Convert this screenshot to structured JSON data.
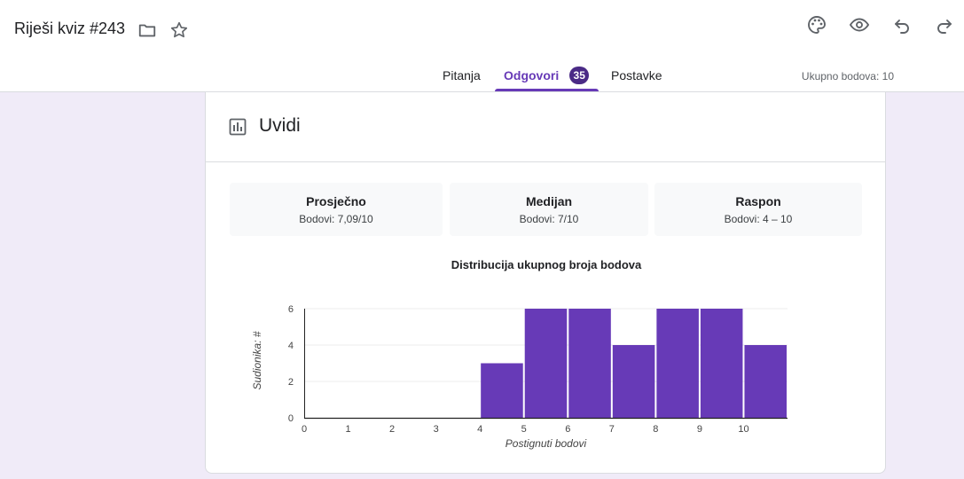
{
  "header": {
    "title": "Riješi kviz #243",
    "icons": [
      "folder-icon",
      "star-icon",
      "palette-icon",
      "eye-icon",
      "undo-icon",
      "redo-icon"
    ]
  },
  "tabs": [
    {
      "label": "Pitanja"
    },
    {
      "label": "Odgovori",
      "badge": "35",
      "active": true
    },
    {
      "label": "Postavke"
    }
  ],
  "points_total": "Ukupno bodova: 10",
  "insights": {
    "title": "Uvidi",
    "stats": [
      {
        "label": "Prosječno",
        "value": "Bodovi: 7,09/10"
      },
      {
        "label": "Medijan",
        "value": "Bodovi: 7/10"
      },
      {
        "label": "Raspon",
        "value": "Bodovi: 4 – 10"
      }
    ]
  },
  "colors": {
    "accent": "#673ab7",
    "bar": "#673ab7",
    "background": "#f0ebf8"
  },
  "chart_data": {
    "type": "bar",
    "title": "Distribucija ukupnog broja bodova",
    "xlabel": "Postignuti bodovi",
    "ylabel": "Sudionika: #",
    "categories": [
      "0",
      "1",
      "2",
      "3",
      "4",
      "5",
      "6",
      "7",
      "8",
      "9",
      "10"
    ],
    "values": [
      0,
      0,
      0,
      0,
      3,
      6,
      6,
      4,
      6,
      6,
      4
    ],
    "yticks": [
      "0",
      "2",
      "4",
      "6"
    ],
    "ylim": [
      0,
      6
    ],
    "grid": true
  }
}
